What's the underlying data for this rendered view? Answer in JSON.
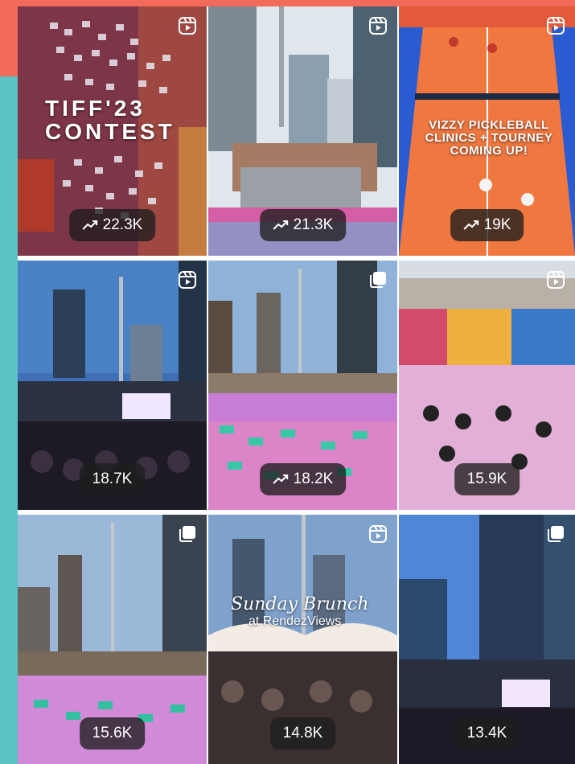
{
  "grid": {
    "posts": [
      {
        "views": "22.3K",
        "trending": true,
        "type": "reel",
        "caption": "TIFF'23\nCONTEST"
      },
      {
        "views": "21.3K",
        "trending": true,
        "type": "reel",
        "caption": ""
      },
      {
        "views": "19K",
        "trending": true,
        "type": "reel",
        "caption": "VIZZY PICKLEBALL CLINICS + TOURNEY COMING UP!"
      },
      {
        "views": "18.7K",
        "trending": false,
        "type": "reel",
        "caption": ""
      },
      {
        "views": "18.2K",
        "trending": true,
        "type": "carousel",
        "caption": ""
      },
      {
        "views": "15.9K",
        "trending": false,
        "type": "reel",
        "caption": ""
      },
      {
        "views": "15.6K",
        "trending": false,
        "type": "carousel",
        "caption": ""
      },
      {
        "views": "14.8K",
        "trending": false,
        "type": "reel",
        "caption": "Sunday Brunch",
        "caption_sub": "at RendezViews"
      },
      {
        "views": "13.4K",
        "trending": false,
        "type": "carousel",
        "caption": ""
      }
    ]
  },
  "icons": {
    "trend": "trending-up-icon",
    "reel": "reel-icon",
    "carousel": "carousel-icon"
  },
  "colors": {
    "badge_bg": "#1e1e1e",
    "coral": "#f26a5a",
    "teal": "#5bc2c6"
  }
}
